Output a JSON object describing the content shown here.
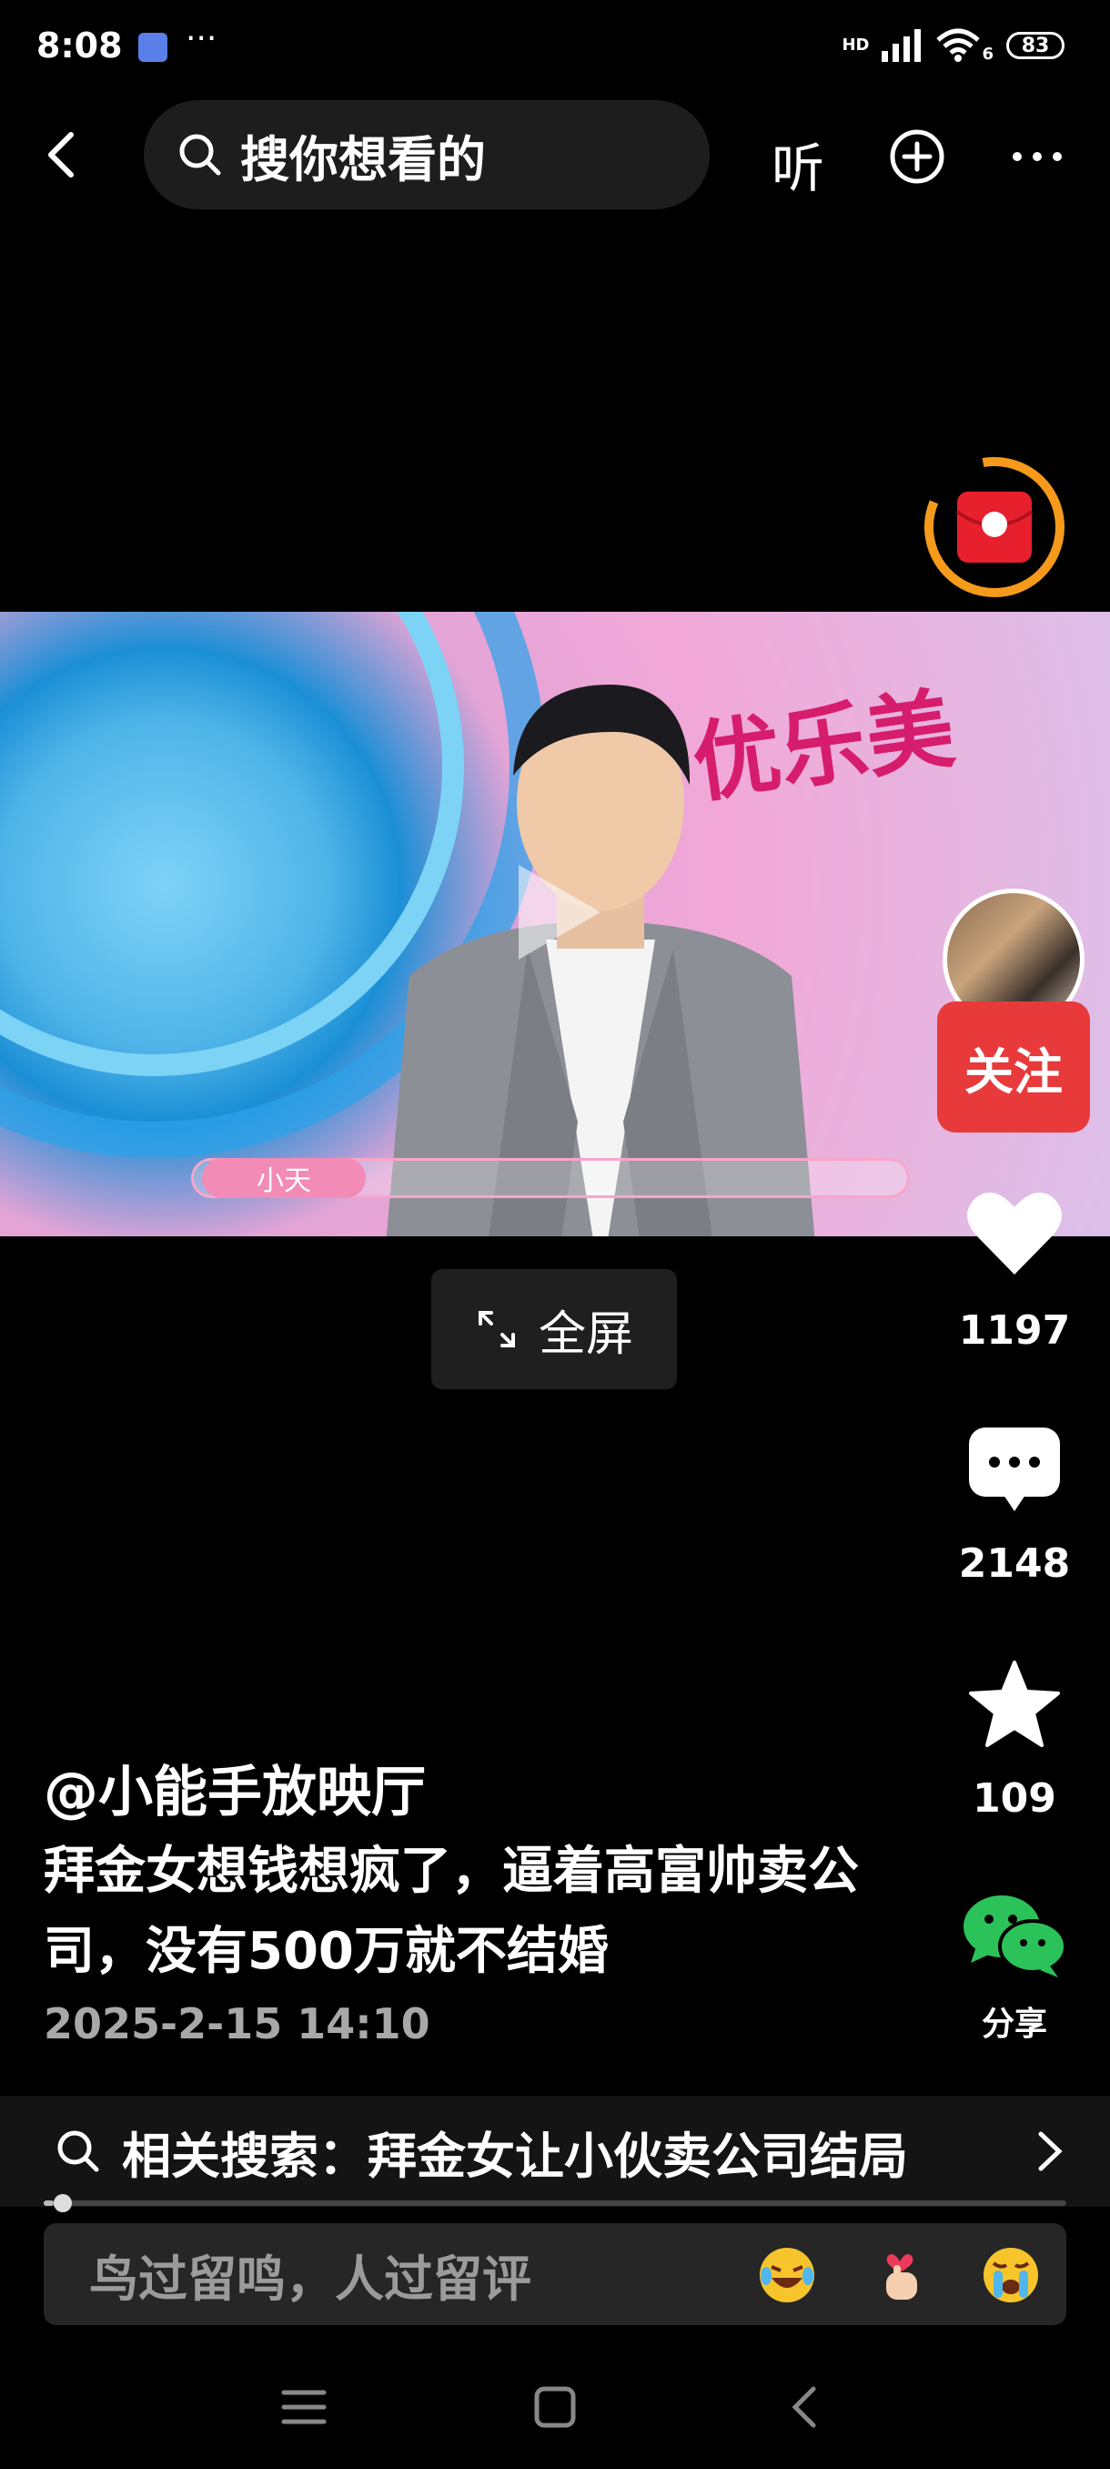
{
  "status_bar": {
    "time": "8:08",
    "more": "···",
    "network": "HD",
    "wifi_badge": "6",
    "battery": "83"
  },
  "top_nav": {
    "search_placeholder": "搜你想看的",
    "listen_label": "听",
    "icons": [
      "back-icon",
      "search-icon",
      "plus-circle-icon",
      "more-dots-icon"
    ]
  },
  "video": {
    "name_tag": "小天",
    "brand_text": "优乐美"
  },
  "fullscreen_label": "全屏",
  "right_rail": {
    "follow_label": "关注",
    "like_count": "1197",
    "comment_count": "2148",
    "favorite_count": "109",
    "share_label": "分享"
  },
  "post": {
    "author": "@小能手放映厅",
    "description": "拜金女想钱想疯了，逼着高富帅卖公司，没有500万就不结婚",
    "date": "2025-2-15 14:10"
  },
  "related_search": {
    "label": "相关搜索：拜金女让小伙卖公司结局"
  },
  "playback_progress": 0.01,
  "comment_bar": {
    "placeholder": "鸟过留鸣，人过留评",
    "emojis": [
      "laughing-tears-emoji",
      "finger-heart-emoji",
      "crying-emoji"
    ]
  },
  "colors": {
    "background": "#000000",
    "follow_red": "#e83a3a",
    "red_packet_ring": "#f59a1b",
    "wechat_green": "#2bc25a"
  }
}
